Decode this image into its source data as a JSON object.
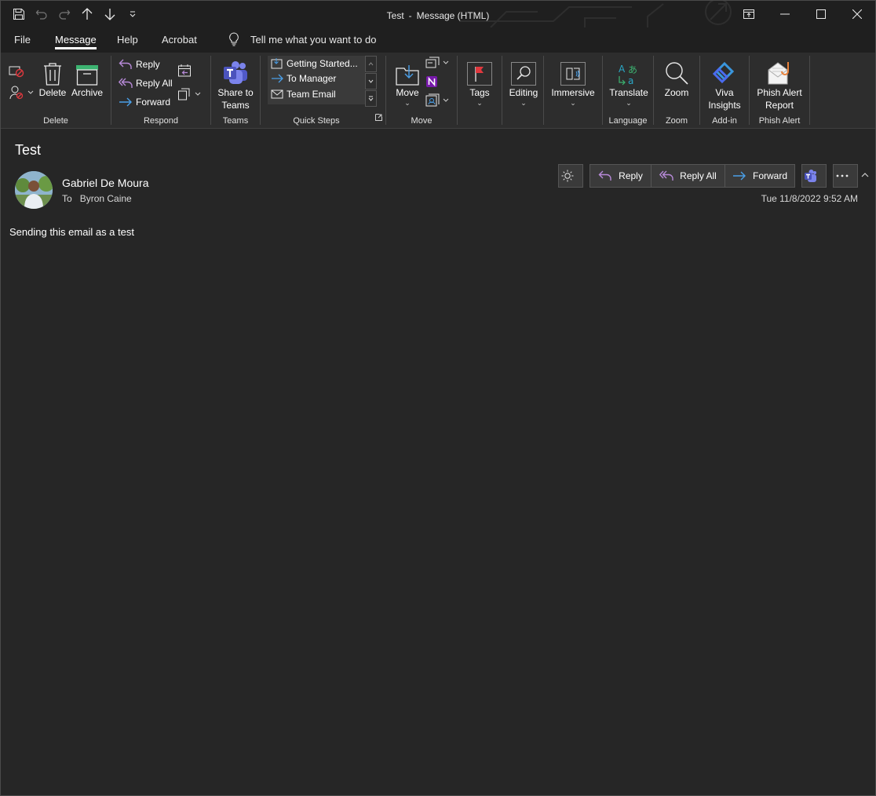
{
  "window": {
    "title_subject": "Test",
    "title_suffix": "Message (HTML)",
    "title_separator": "-"
  },
  "quick_access": {
    "icons": [
      "save-icon",
      "undo-icon",
      "redo-icon",
      "up-arrow-icon",
      "down-arrow-icon",
      "customize-qat-icon"
    ]
  },
  "tabs": {
    "file": "File",
    "message": "Message",
    "help": "Help",
    "acrobat": "Acrobat",
    "tell_me": "Tell me what you want to do"
  },
  "ribbon": {
    "delete_group": {
      "label": "Delete",
      "delete": "Delete",
      "archive": "Archive"
    },
    "respond_group": {
      "label": "Respond",
      "reply": "Reply",
      "reply_all": "Reply All",
      "forward": "Forward"
    },
    "teams_group": {
      "label": "Teams",
      "share_line1": "Share to",
      "share_line2": "Teams"
    },
    "quick_steps_group": {
      "label": "Quick Steps",
      "items": [
        "Getting Started...",
        "To Manager",
        "Team Email"
      ]
    },
    "move_group": {
      "label": "Move",
      "move": "Move"
    },
    "tags": "Tags",
    "editing": "Editing",
    "immersive": "Immersive",
    "language_group": {
      "label": "Language",
      "translate": "Translate"
    },
    "zoom_group": {
      "label": "Zoom",
      "zoom": "Zoom"
    },
    "addin_group": {
      "label": "Add-in",
      "viva_line1": "Viva",
      "viva_line2": "Insights"
    },
    "phish_group": {
      "label": "Phish Alert",
      "phish_line1": "Phish Alert",
      "phish_line2": "Report"
    }
  },
  "message": {
    "subject": "Test",
    "sender": "Gabriel De Moura",
    "to_label": "To",
    "to_value": "Byron Caine",
    "date": "Tue 11/8/2022 9:52 AM",
    "body": "Sending this email as a test"
  },
  "actions": {
    "reply": "Reply",
    "reply_all": "Reply All",
    "forward": "Forward"
  },
  "colors": {
    "background": "#262626",
    "titlebar": "#1f1f1f",
    "ribbon": "#2d2d2d",
    "reply_accent": "#b78ad8",
    "forward_accent": "#4a9fe8",
    "teams_accent": "#6264a7",
    "flag_red": "#e0383e"
  }
}
